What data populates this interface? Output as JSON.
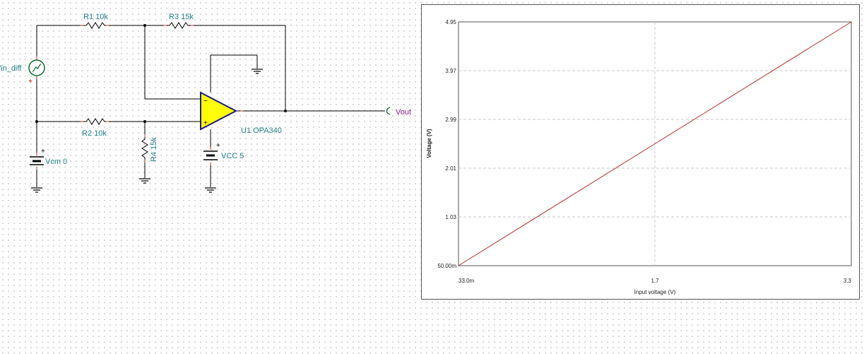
{
  "schematic": {
    "source_label": "Vin_diff",
    "r1": "R1 10k",
    "r2": "R2 10k",
    "r3": "R3 15k",
    "r4": "R4 15k",
    "vcm": "Vcm 0",
    "opamp": "U1 OPA340",
    "vcc": "VCC 5",
    "out": "Vout"
  },
  "chart_data": {
    "type": "line",
    "xlabel": "Input voltage (V)",
    "ylabel": "Voltage (V)",
    "xlim": [
      0.033,
      3.3
    ],
    "ylim": [
      0.05,
      4.95
    ],
    "x_ticks": [
      "33.0m",
      "1.7",
      "3.3"
    ],
    "y_ticks": [
      "50.00m",
      "1.03",
      "2.01",
      "2.99",
      "3.97",
      "4.95"
    ],
    "grid": true,
    "series": [
      {
        "color": "#b0302a",
        "x": [
          0.033,
          3.3
        ],
        "y": [
          0.05,
          4.95
        ]
      }
    ]
  }
}
